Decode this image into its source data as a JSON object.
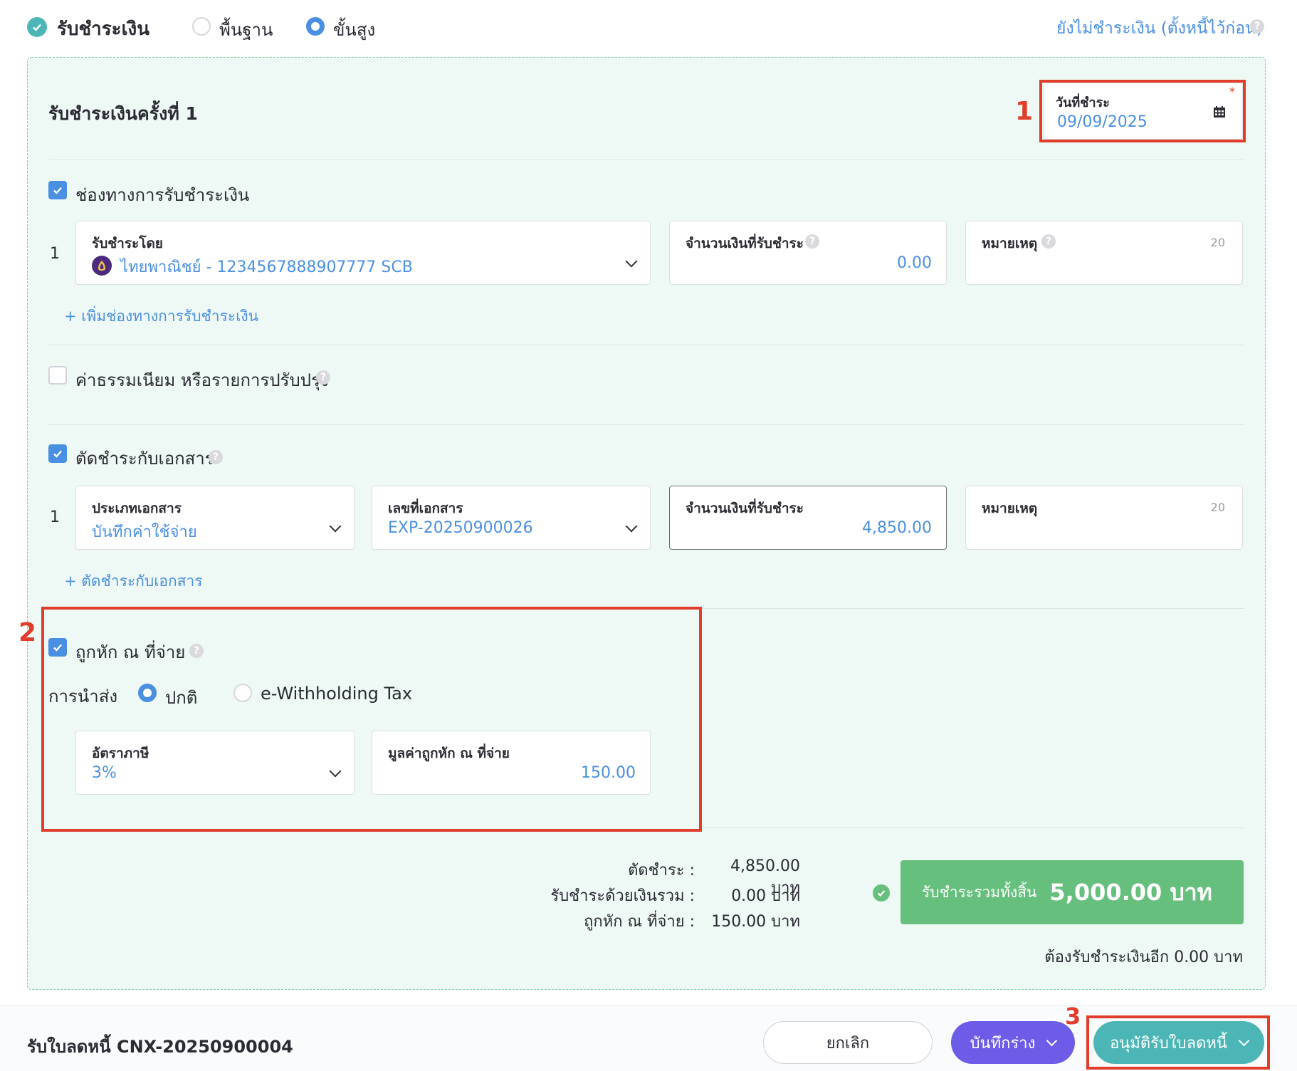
{
  "header": {
    "title": "รับชำระเงิน",
    "mode_basic": "พื้นฐาน",
    "mode_advanced": "ขั้นสูง",
    "unpaid_link": "ยังไม่ชำระเงิน (ตั้งหนี้ไว้ก่อน)"
  },
  "payment": {
    "title": "รับชำระเงินครั้งที่ 1",
    "date_label": "วันที่ชำระ",
    "date_value": "09/09/2025",
    "required_mark": "*"
  },
  "channels": {
    "label": "ช่องทางการรับชำระเงิน",
    "row_number": "1",
    "method_label": "รับชำระโดย",
    "method_value": "ไทยพาณิชย์ - 1234567888907777 SCB",
    "amount_label": "จำนวนเงินที่รับชำระ",
    "amount_value": "0.00",
    "note_label": "หมายเหตุ",
    "note_counter": "20",
    "add_link": "+ เพิ่มช่องทางการรับชำระเงิน"
  },
  "fees": {
    "label": "ค่าธรรมเนียม หรือรายการปรับปรุง"
  },
  "documents": {
    "label": "ตัดชำระกับเอกสาร",
    "row_number": "1",
    "type_label": "ประเภทเอกสาร",
    "type_value": "บันทึกค่าใช้จ่าย",
    "docno_label": "เลขที่เอกสาร",
    "docno_value": "EXP-20250900026",
    "amount_label": "จำนวนเงินที่รับชำระ",
    "amount_value": "4,850.00",
    "note_label": "หมายเหตุ",
    "note_counter": "20",
    "add_link": "+ ตัดชำระกับเอกสาร"
  },
  "withholding": {
    "label": "ถูกหัก ณ ที่จ่าย",
    "submit_label": "การนำส่ง",
    "option_normal": "ปกติ",
    "option_ewht": "e-Withholding Tax",
    "rate_label": "อัตราภาษี",
    "rate_value": "3%",
    "value_label": "มูลค่าถูกหัก ณ ที่จ่าย",
    "value_value": "150.00"
  },
  "summary": {
    "cut_label": "ตัดชำระ :",
    "cut_value": "4,850.00 บาท",
    "money_label": "รับชำระด้วยเงินรวม :",
    "money_value": "0.00 บาท",
    "wht_label": "ถูกหัก ณ ที่จ่าย :",
    "wht_value": "150.00 บาท",
    "total_label": "รับชำระรวมทั้งสิ้น",
    "total_value": "5,000.00 บาท",
    "remaining": "ต้องรับชำระเงินอีก 0.00 บาท"
  },
  "footer": {
    "doc_title": "รับใบลดหนี้ CNX-20250900004",
    "cancel": "ยกเลิก",
    "save_draft": "บันทึกร่าง",
    "approve": "อนุมัติรับใบลดหนี้"
  },
  "annotations": [
    "1",
    "2",
    "3"
  ],
  "colors": {
    "accent": "#4a90e2",
    "teal": "#4cb6b6",
    "green": "#66bf7c",
    "purple": "#6c5ce7",
    "annotation_red": "#e03d2a",
    "panel_bg": "#eef8f4"
  },
  "icons": [
    "check-circle-icon",
    "calendar-icon",
    "chevron-down-icon",
    "help-icon",
    "bank-logo-icon",
    "checkbox-icon"
  ]
}
